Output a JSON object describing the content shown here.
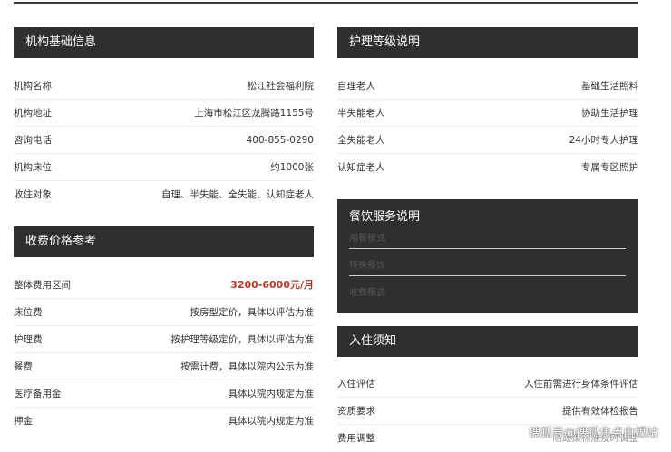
{
  "basic": {
    "title": "机构基础信息",
    "rows": [
      {
        "k": "机构名称",
        "v": "松江社会福利院"
      },
      {
        "k": "机构地址",
        "v": "上海市松江区龙腾路1155号"
      },
      {
        "k": "咨询电话",
        "v": "400-855-0290"
      },
      {
        "k": "机构床位",
        "v": "约1000张"
      },
      {
        "k": "收住对象",
        "v": "自理、半失能、全失能、认知症老人"
      }
    ]
  },
  "fees": {
    "title": "收费价格参考",
    "rows": [
      {
        "k": "整体费用区间",
        "v": "3200-6000元/月"
      },
      {
        "k": "床位费",
        "v": "按房型定价，具体以评估为准"
      },
      {
        "k": "护理费",
        "v": "按护理等级定价，具体以评估为准"
      },
      {
        "k": "餐费",
        "v": "按需计费，具体以院内公示为准"
      },
      {
        "k": "医疗备用金",
        "v": "具体以院内规定为准"
      },
      {
        "k": "押金",
        "v": "具体以院内规定为准"
      }
    ]
  },
  "care": {
    "title": "护理等级说明",
    "rows": [
      {
        "k": "自理老人",
        "v": "基础生活照料"
      },
      {
        "k": "半失能老人",
        "v": "协助生活护理"
      },
      {
        "k": "全失能老人",
        "v": "24小时专人护理"
      },
      {
        "k": "认知症老人",
        "v": "专属专区照护"
      }
    ]
  },
  "dining": {
    "title": "餐饮服务说明",
    "items": [
      "用餐模式",
      "特殊餐饮",
      "收费模式"
    ]
  },
  "admission": {
    "title": "入住须知",
    "rows": [
      {
        "k": "入住评估",
        "v": "入住前需进行身体条件评估"
      },
      {
        "k": "资质要求",
        "v": "提供有效体检报告"
      },
      {
        "k": "费用调整",
        "v": "随政策标准及时调整"
      }
    ]
  },
  "watermark": "搜狐号@搜狐焦点自媒站"
}
